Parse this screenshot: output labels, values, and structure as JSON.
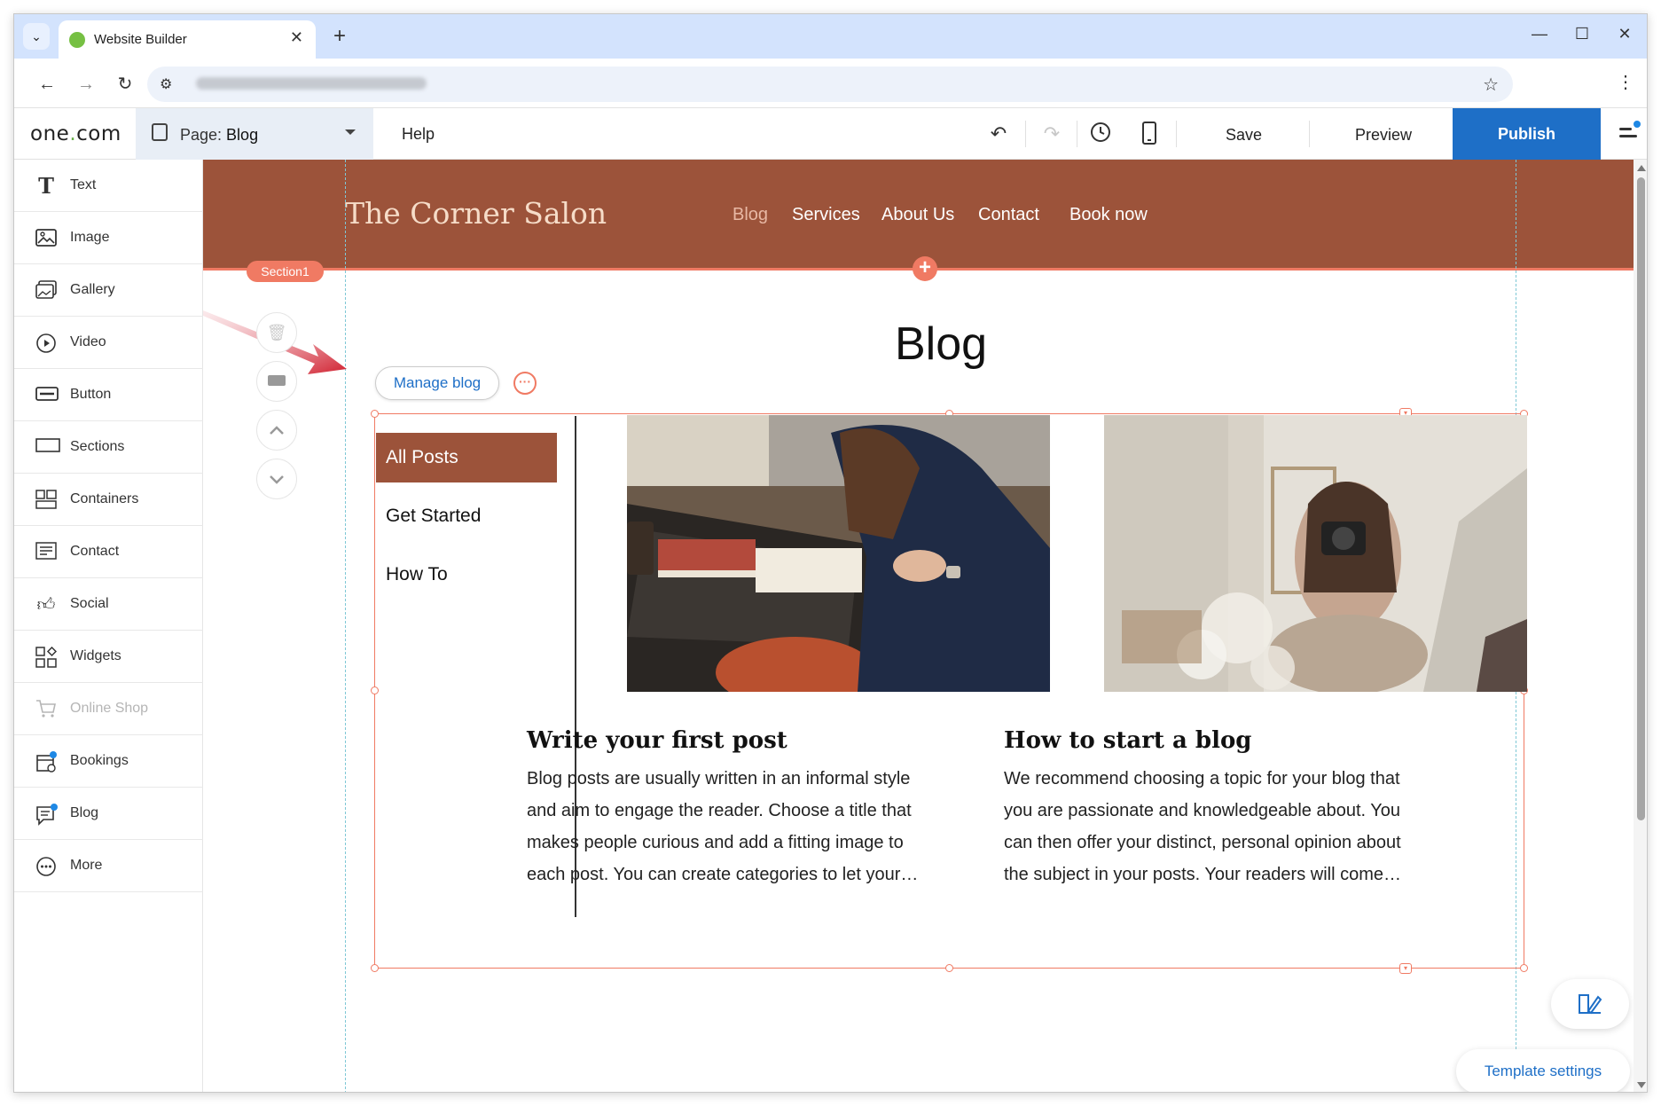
{
  "browser": {
    "tab_title": "Website Builder",
    "new_tab": "+",
    "close": "✕",
    "minimize": "—",
    "maximize": "☐",
    "window_close": "✕"
  },
  "toolbar": {
    "logo_part1": "one",
    "logo_dot": ".",
    "logo_part2": "com",
    "page_prefix": "Page: ",
    "page_name": "Blog",
    "help": "Help",
    "save": "Save",
    "preview": "Preview",
    "publish": "Publish"
  },
  "sidebar": {
    "items": [
      {
        "label": "Text",
        "icon": "T"
      },
      {
        "label": "Image",
        "icon": "image-icon"
      },
      {
        "label": "Gallery",
        "icon": "gallery-icon"
      },
      {
        "label": "Video",
        "icon": "video-icon"
      },
      {
        "label": "Button",
        "icon": "button-icon"
      },
      {
        "label": "Sections",
        "icon": "sections-icon"
      },
      {
        "label": "Containers",
        "icon": "containers-icon"
      },
      {
        "label": "Contact",
        "icon": "contact-icon"
      },
      {
        "label": "Social",
        "icon": "social-icon"
      },
      {
        "label": "Widgets",
        "icon": "widgets-icon"
      },
      {
        "label": "Online Shop",
        "icon": "cart-icon",
        "disabled": true
      },
      {
        "label": "Bookings",
        "icon": "bookings-icon"
      },
      {
        "label": "Blog",
        "icon": "blog-icon"
      },
      {
        "label": "More",
        "icon": "more-icon"
      }
    ]
  },
  "site": {
    "name": "The Corner Salon",
    "nav": [
      "Blog",
      "Services",
      "About Us",
      "Contact",
      "Book now"
    ],
    "section_badge": "Section1"
  },
  "blog": {
    "title": "Blog",
    "manage_blog": "Manage blog",
    "categories": [
      "All Posts",
      "Get Started",
      "How To"
    ],
    "posts": [
      {
        "title": "Write your first post",
        "excerpt_lines": [
          "Blog posts are usually written in an informal style",
          "and aim to engage the reader. Choose a title that",
          "makes people curious and add a fitting image to",
          "each post. You can create categories to let your…"
        ]
      },
      {
        "title": "How to start a blog",
        "excerpt_lines": [
          "We recommend choosing a topic for your blog that",
          "you are passionate and knowledgeable about. You",
          "can then offer your distinct, personal opinion about",
          "the subject in your posts. Your readers will come…"
        ]
      }
    ]
  },
  "template_settings": "Template settings",
  "colors": {
    "header_brown": "#9c533a",
    "accent_coral": "#f07a63",
    "publish_blue": "#1e6fc7"
  }
}
